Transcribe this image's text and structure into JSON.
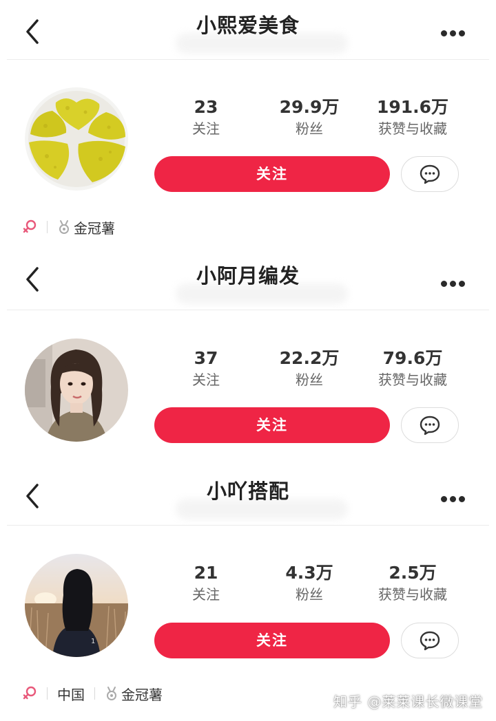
{
  "profiles": [
    {
      "name": "小熙爱美食",
      "stats": [
        {
          "value": "23",
          "label": "关注"
        },
        {
          "value": "29.9万",
          "label": "粉丝"
        },
        {
          "value": "191.6万",
          "label": "获赞与收藏"
        }
      ],
      "follow_label": "关注",
      "tags": {
        "badge": "金冠薯"
      }
    },
    {
      "name": "小阿月编发",
      "stats": [
        {
          "value": "37",
          "label": "关注"
        },
        {
          "value": "22.2万",
          "label": "粉丝"
        },
        {
          "value": "79.6万",
          "label": "获赞与收藏"
        }
      ],
      "follow_label": "关注"
    },
    {
      "name": "小吖搭配",
      "stats": [
        {
          "value": "21",
          "label": "关注"
        },
        {
          "value": "4.3万",
          "label": "粉丝"
        },
        {
          "value": "2.5万",
          "label": "获赞与收藏"
        }
      ],
      "follow_label": "关注",
      "tags": {
        "location": "中国",
        "badge": "金冠薯"
      }
    }
  ],
  "icons": {
    "back": "chevron-left-icon",
    "more": "more-dots-icon",
    "message": "chat-bubble-icon",
    "gender": "female-icon",
    "badge": "medal-icon"
  },
  "colors": {
    "accent": "#ef2545",
    "gender": "#e8587a"
  },
  "watermark": "知乎 @莱莱课长微课堂"
}
